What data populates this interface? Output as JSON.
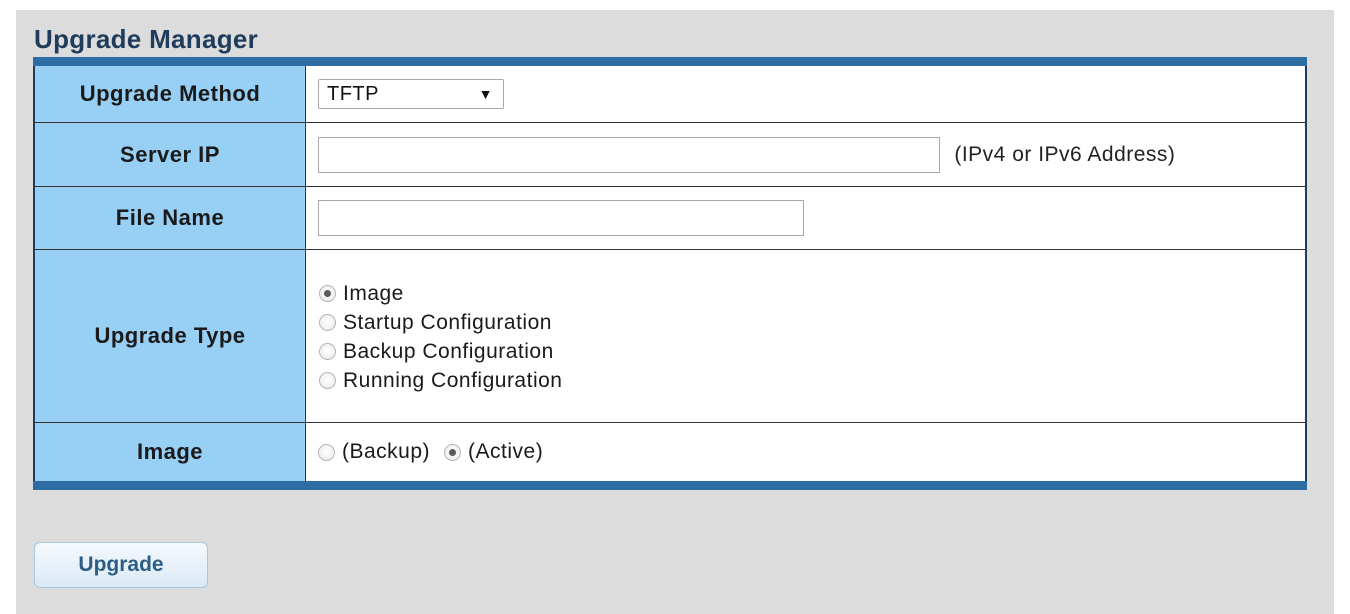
{
  "page": {
    "title": "Upgrade Manager"
  },
  "form": {
    "upgrade_method": {
      "label": "Upgrade Method",
      "selected": "TFTP"
    },
    "server_ip": {
      "label": "Server IP",
      "value": "",
      "hint": "(IPv4 or IPv6 Address)"
    },
    "file_name": {
      "label": "File Name",
      "value": ""
    },
    "upgrade_type": {
      "label": "Upgrade Type",
      "options": [
        {
          "label": "Image",
          "checked": true
        },
        {
          "label": "Startup Configuration",
          "checked": false
        },
        {
          "label": "Backup Configuration",
          "checked": false
        },
        {
          "label": "Running Configuration",
          "checked": false
        }
      ]
    },
    "image": {
      "label": "Image",
      "options": [
        {
          "label": "(Backup)",
          "checked": false
        },
        {
          "label": "(Active)",
          "checked": true
        }
      ]
    }
  },
  "actions": {
    "upgrade_label": "Upgrade"
  },
  "colors": {
    "label_bg": "#97cff5",
    "table_border": "#2d6da4",
    "title": "#1f3c5c",
    "panel_bg": "#dcdcdc"
  }
}
